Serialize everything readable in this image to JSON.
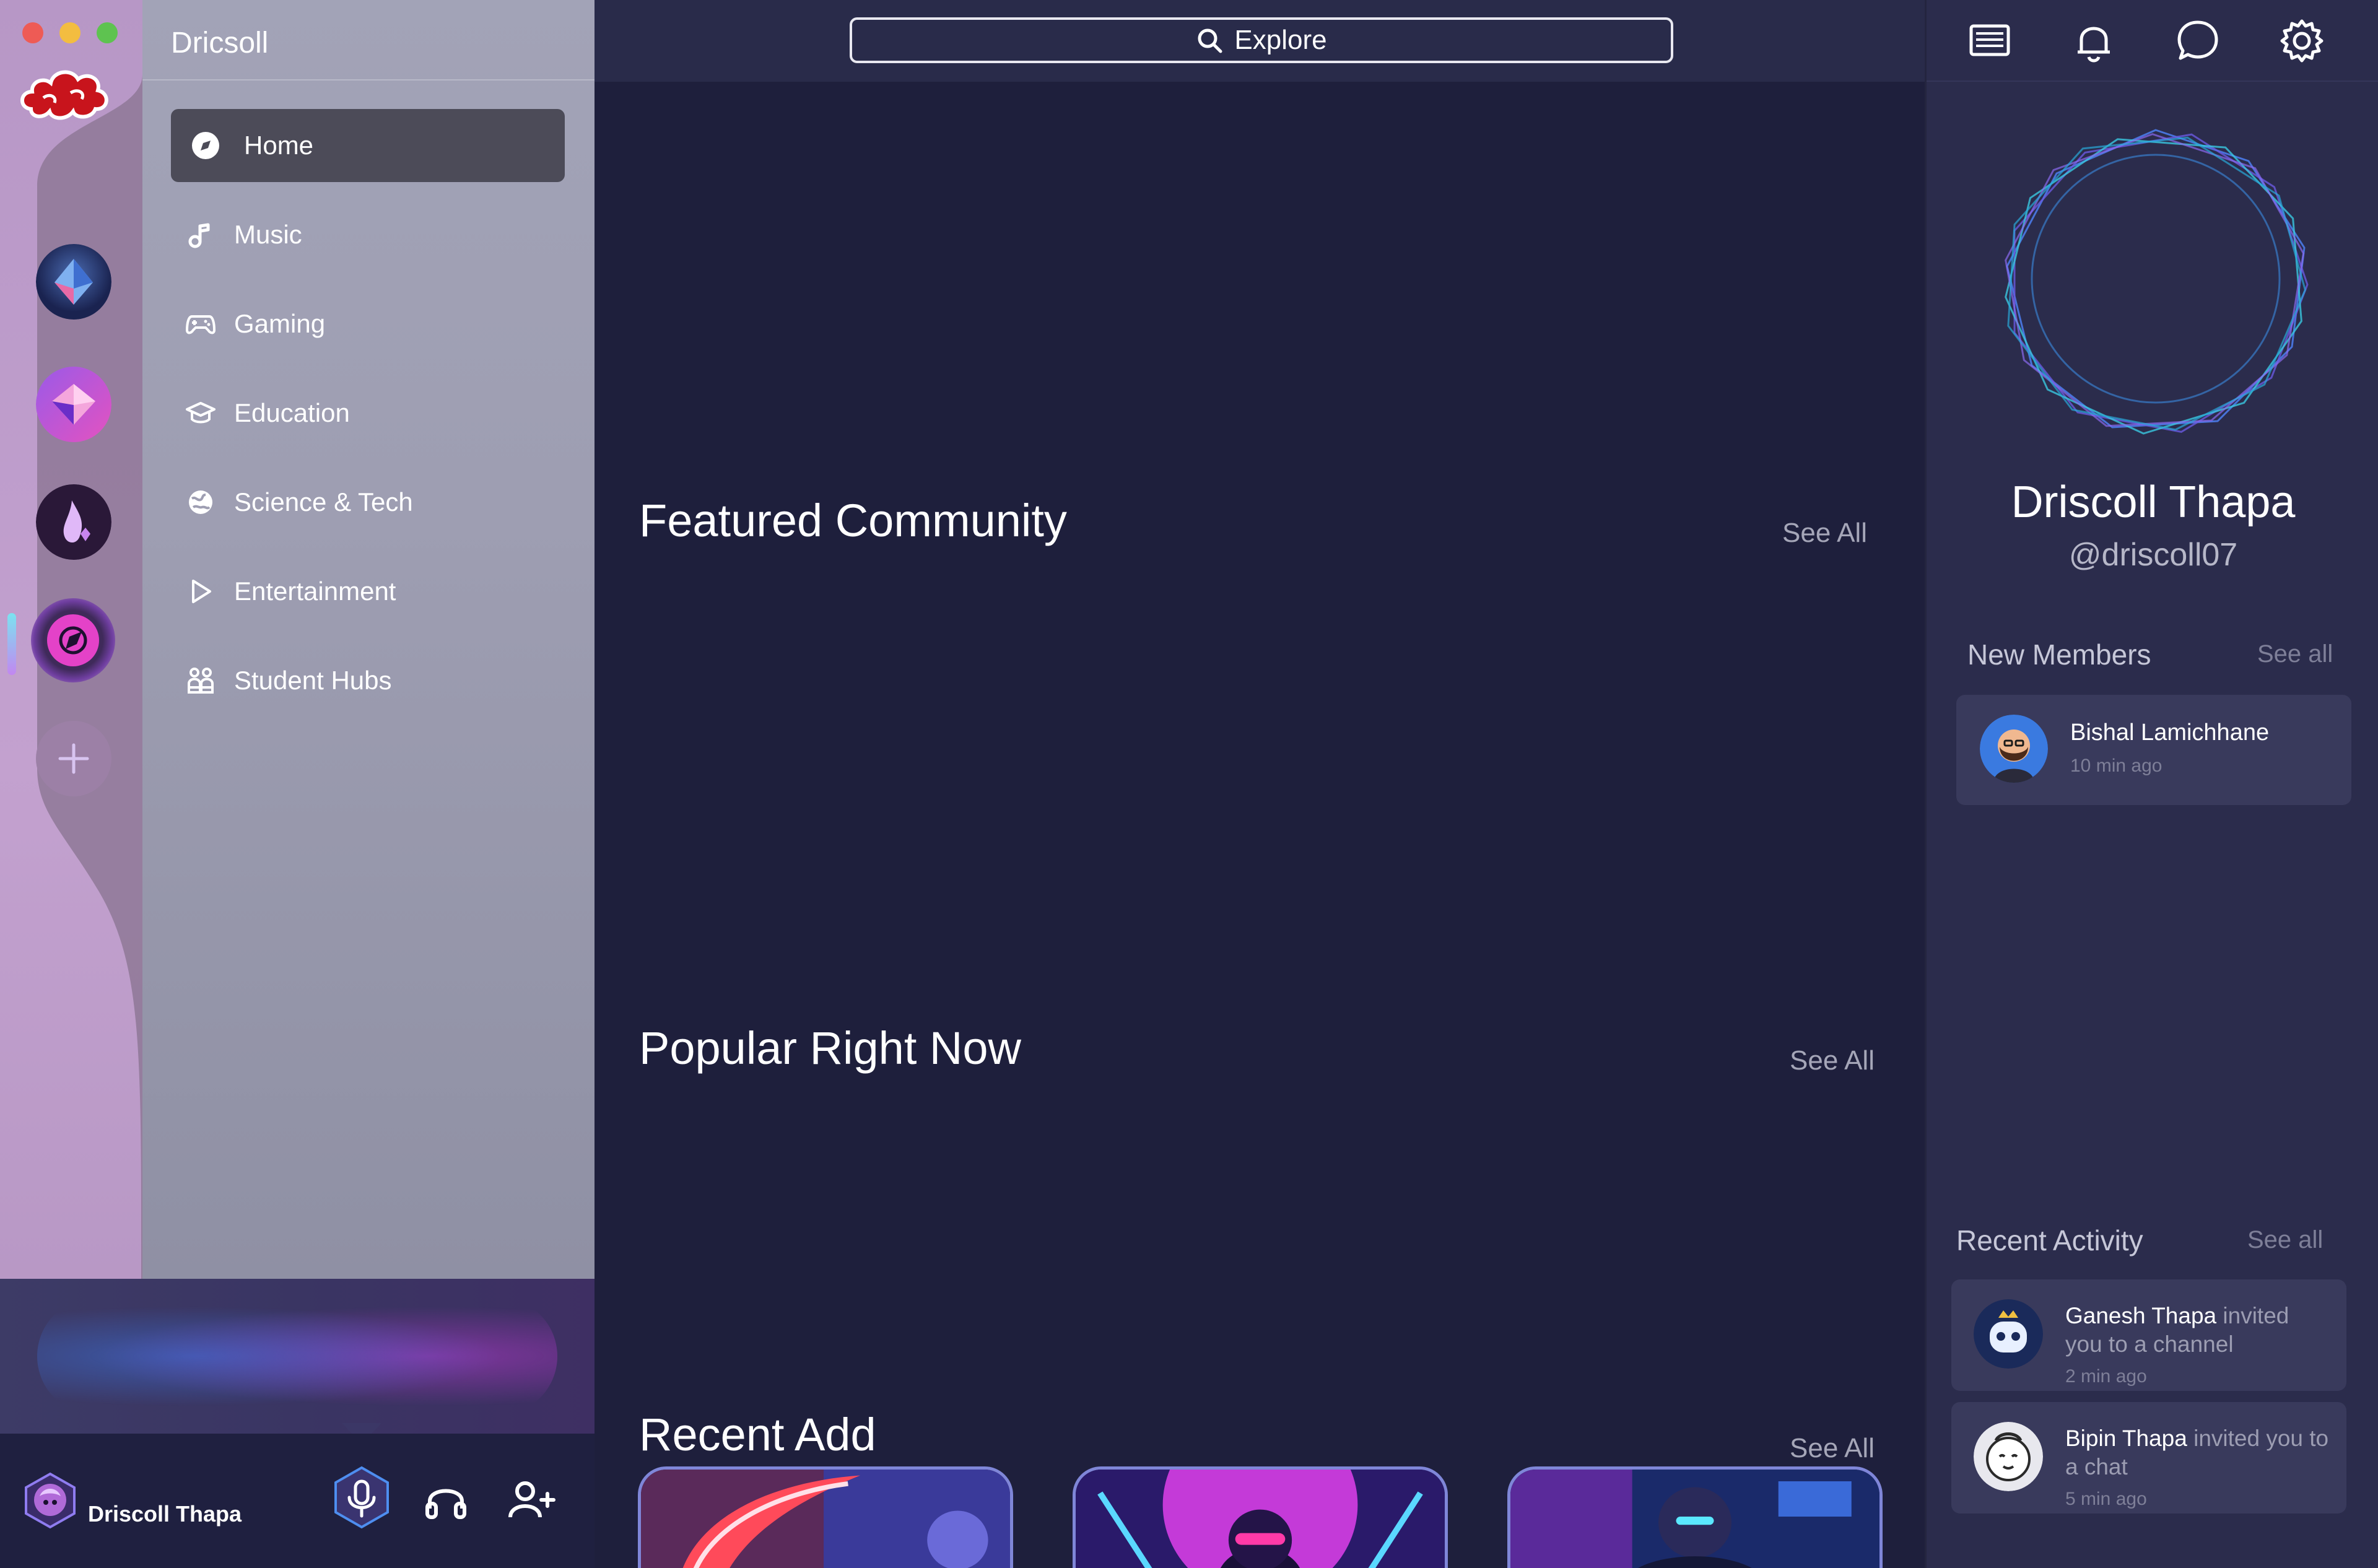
{
  "app": {
    "workspace_name": "Dricsoll"
  },
  "sidebar": {
    "items": [
      {
        "label": "Home",
        "icon": "compass-icon",
        "active": true
      },
      {
        "label": "Music",
        "icon": "music-note-icon"
      },
      {
        "label": "Gaming",
        "icon": "gamepad-icon"
      },
      {
        "label": "Education",
        "icon": "graduation-cap-icon"
      },
      {
        "label": "Science & Tech",
        "icon": "globe-icon"
      },
      {
        "label": "Entertainment",
        "icon": "play-icon"
      },
      {
        "label": "Student Hubs",
        "icon": "group-icon"
      }
    ]
  },
  "servers": [
    {
      "icon": "crystal-server-icon"
    },
    {
      "icon": "gem-server-icon"
    },
    {
      "icon": "flame-server-icon"
    },
    {
      "icon": "explore-compass-icon",
      "active": true
    },
    {
      "icon": "add-server-icon"
    }
  ],
  "user": {
    "name": "Driscoll Thapa"
  },
  "search": {
    "label": "Explore"
  },
  "main": {
    "sections": [
      {
        "title": "Featured Community",
        "see_all": "See All"
      },
      {
        "title": "Popular Right Now",
        "see_all": "See All"
      },
      {
        "title": "Recent Add",
        "see_all": "See All"
      }
    ]
  },
  "profile": {
    "name": "Driscoll Thapa",
    "handle": "@driscoll07"
  },
  "new_members": {
    "heading": "New Members",
    "see_all": "See all",
    "items": [
      {
        "name": "Bishal Lamichhane",
        "time": "10 min ago"
      }
    ]
  },
  "recent_activity": {
    "heading": "Recent Activity",
    "see_all": "See all",
    "items": [
      {
        "who": "Ganesh Thapa",
        "action": "invited you to a channel",
        "time": "2 min ago"
      },
      {
        "who": "Bipin Thapa",
        "action": "invited you to a chat",
        "time": "5 min ago"
      }
    ]
  },
  "colors": {
    "main_bg": "#1e1f3c",
    "sidebar_bg": "#9e9eb2",
    "rail_bg": "#c3a1cf",
    "right_panel_bg": "#2b2c4c",
    "card_bg": "#393a5c",
    "accent_blue": "#3ea0ff",
    "accent_pink": "#e040e0"
  }
}
